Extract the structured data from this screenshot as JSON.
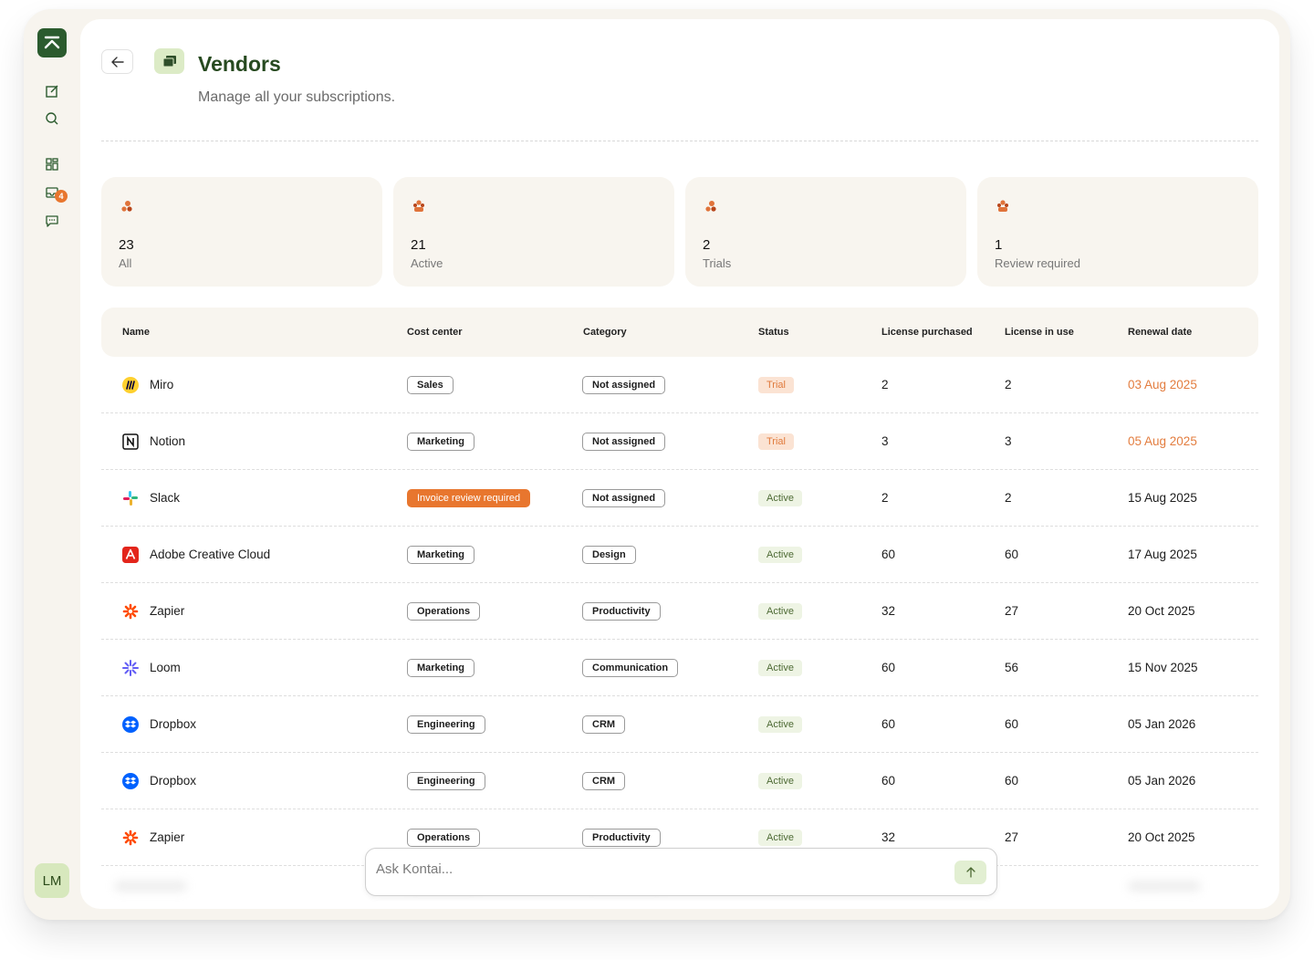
{
  "sidebar": {
    "logo": "app-logo",
    "icons": [
      "compose-icon",
      "search-icon",
      "dashboard-icon",
      "inbox-icon",
      "chat-icon"
    ],
    "inbox_badge": "4",
    "avatar_initials": "LM"
  },
  "header": {
    "title": "Vendors",
    "subtitle": "Manage all your subscriptions."
  },
  "stats": [
    {
      "value": "23",
      "label": "All",
      "icon": "vendors-icon"
    },
    {
      "value": "21",
      "label": "Active",
      "icon": "users-icon"
    },
    {
      "value": "2",
      "label": "Trials",
      "icon": "vendors-icon"
    },
    {
      "value": "1",
      "label": "Review required",
      "icon": "users-icon"
    }
  ],
  "table": {
    "columns": [
      "Name",
      "Cost center",
      "Category",
      "Status",
      "License purchased",
      "License in use",
      "Renewal date"
    ],
    "rows": [
      {
        "name": "Miro",
        "logo": "miro-logo",
        "cost_center": "Sales",
        "cost_warn": false,
        "category": "Not assigned",
        "status": "Trial",
        "purchased": "2",
        "in_use": "2",
        "renewal": "03 Aug 2025",
        "soon": true
      },
      {
        "name": "Notion",
        "logo": "notion-logo",
        "cost_center": "Marketing",
        "cost_warn": false,
        "category": "Not assigned",
        "status": "Trial",
        "purchased": "3",
        "in_use": "3",
        "renewal": "05 Aug 2025",
        "soon": true
      },
      {
        "name": "Slack",
        "logo": "slack-logo",
        "cost_center": "Invoice review required",
        "cost_warn": true,
        "category": "Not assigned",
        "status": "Active",
        "purchased": "2",
        "in_use": "2",
        "renewal": "15 Aug 2025",
        "soon": false
      },
      {
        "name": "Adobe Creative Cloud",
        "logo": "adobe-logo",
        "cost_center": "Marketing",
        "cost_warn": false,
        "category": "Design",
        "status": "Active",
        "purchased": "60",
        "in_use": "60",
        "renewal": "17 Aug 2025",
        "soon": false
      },
      {
        "name": "Zapier",
        "logo": "zapier-logo",
        "cost_center": "Operations",
        "cost_warn": false,
        "category": "Productivity",
        "status": "Active",
        "purchased": "32",
        "in_use": "27",
        "renewal": "20 Oct 2025",
        "soon": false
      },
      {
        "name": "Loom",
        "logo": "loom-logo",
        "cost_center": "Marketing",
        "cost_warn": false,
        "category": "Communication",
        "status": "Active",
        "purchased": "60",
        "in_use": "56",
        "renewal": "15 Nov 2025",
        "soon": false
      },
      {
        "name": "Dropbox",
        "logo": "dropbox-logo",
        "cost_center": "Engineering",
        "cost_warn": false,
        "category": "CRM",
        "status": "Active",
        "purchased": "60",
        "in_use": "60",
        "renewal": "05 Jan 2026",
        "soon": false
      },
      {
        "name": "Dropbox",
        "logo": "dropbox-logo",
        "cost_center": "Engineering",
        "cost_warn": false,
        "category": "CRM",
        "status": "Active",
        "purchased": "60",
        "in_use": "60",
        "renewal": "05 Jan 2026",
        "soon": false
      },
      {
        "name": "Zapier",
        "logo": "zapier-logo",
        "cost_center": "Operations",
        "cost_warn": false,
        "category": "Productivity",
        "status": "Active",
        "purchased": "32",
        "in_use": "27",
        "renewal": "20 Oct 2025",
        "soon": false
      }
    ]
  },
  "ask": {
    "placeholder": "Ask Kontai..."
  },
  "colors": {
    "brand_green": "#2b5b2e",
    "accent_orange": "#e8762e",
    "frame_bg": "#f7f4ee"
  }
}
